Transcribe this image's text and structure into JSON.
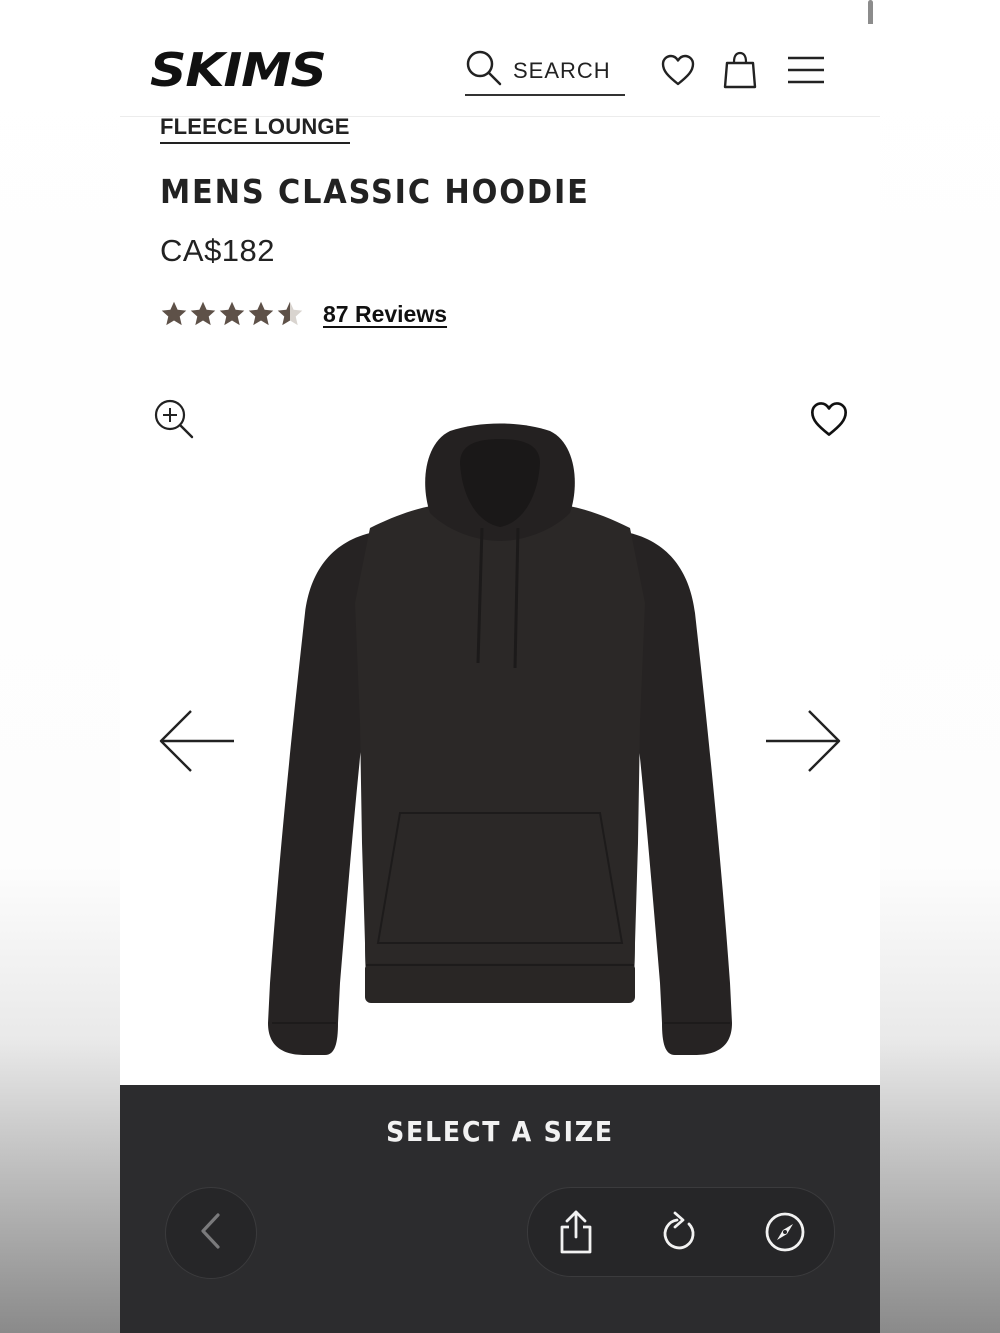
{
  "header": {
    "logo": "SKIMS",
    "search_label": "SEARCH",
    "icons": [
      "search-icon",
      "heart-icon",
      "shopping-bag-icon",
      "menu-icon"
    ]
  },
  "product": {
    "breadcrumb": "FLEECE LOUNGE",
    "title": "MENS CLASSIC HOODIE",
    "price": "CA$182",
    "rating": 4.5,
    "rating_max": 5,
    "reviews_label": "87 Reviews"
  },
  "gallery": {
    "image_alt": "Black hoodie",
    "icons": [
      "zoom-in-icon",
      "wishlist-heart-icon",
      "arrow-left-icon",
      "arrow-right-icon"
    ]
  },
  "purchase": {
    "select_size_label": "SELECT A SIZE"
  },
  "browser_toolbar": {
    "icons": [
      "chevron-left-icon",
      "share-icon",
      "reload-icon",
      "compass-icon"
    ]
  },
  "colors": {
    "star": "#5e5148",
    "toolbar_bg": "#2c2c2e",
    "text": "#222222"
  }
}
